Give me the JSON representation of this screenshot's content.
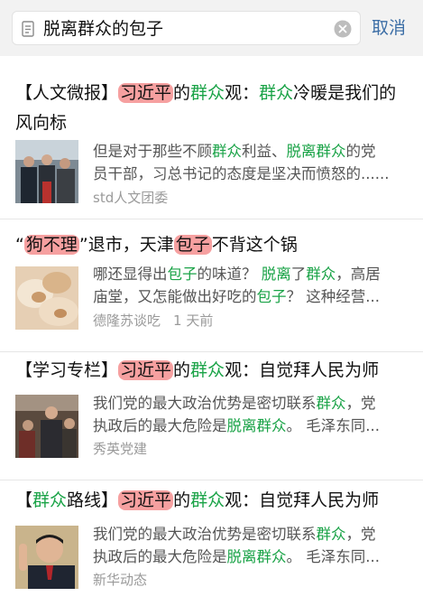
{
  "search": {
    "query": "脱离群众的包子",
    "cancel_label": "取消"
  },
  "results": [
    {
      "title": [
        {
          "t": "【人文微报】",
          "s": "n"
        },
        {
          "t": "习近平",
          "s": "r"
        },
        {
          "t": "的",
          "s": "n"
        },
        {
          "t": "群众",
          "s": "g"
        },
        {
          "t": "观：",
          "s": "n"
        },
        {
          "t": "群众",
          "s": "g"
        },
        {
          "t": "冷暖是我们的风向标",
          "s": "n"
        }
      ],
      "snippet_lines": [
        [
          {
            "t": "但是对于那些不顾",
            "s": "n"
          },
          {
            "t": "群众",
            "s": "g"
          },
          {
            "t": "利益、",
            "s": "n"
          },
          {
            "t": "脱离群众",
            "s": "g"
          },
          {
            "t": "的党",
            "s": "n"
          }
        ],
        [
          {
            "t": "员干部，习总书记的态度是坚决而愤怒的......",
            "s": "n"
          }
        ]
      ],
      "source": "std人文团委",
      "time": ""
    },
    {
      "title": [
        {
          "t": "“",
          "s": "n"
        },
        {
          "t": "狗不理",
          "s": "r"
        },
        {
          "t": "”退市，天津",
          "s": "n"
        },
        {
          "t": "包子",
          "s": "r"
        },
        {
          "t": "不背这个锅",
          "s": "n"
        }
      ],
      "snippet_lines": [
        [
          {
            "t": "哪还显得出",
            "s": "n"
          },
          {
            "t": "包子",
            "s": "g"
          },
          {
            "t": "的味道？ ",
            "s": "n"
          },
          {
            "t": "脱离",
            "s": "g"
          },
          {
            "t": "了",
            "s": "n"
          },
          {
            "t": "群众",
            "s": "g"
          },
          {
            "t": "，高居",
            "s": "n"
          }
        ],
        [
          {
            "t": "庙堂，又怎能做出好吃的",
            "s": "n"
          },
          {
            "t": "包子",
            "s": "g"
          },
          {
            "t": "？ 这种经营...",
            "s": "n"
          }
        ]
      ],
      "source": "德隆苏谈吃",
      "time": "1 天前"
    },
    {
      "title": [
        {
          "t": "【学习专栏】",
          "s": "n"
        },
        {
          "t": "习近平",
          "s": "r"
        },
        {
          "t": "的",
          "s": "n"
        },
        {
          "t": "群众",
          "s": "g"
        },
        {
          "t": "观：自觉拜人民为师",
          "s": "n"
        }
      ],
      "snippet_lines": [
        [
          {
            "t": "我们党的最大政治优势是密切联系",
            "s": "n"
          },
          {
            "t": "群众",
            "s": "g"
          },
          {
            "t": "，党",
            "s": "n"
          }
        ],
        [
          {
            "t": "执政后的最大危险是",
            "s": "n"
          },
          {
            "t": "脱离群众",
            "s": "g"
          },
          {
            "t": "。 毛泽东同...",
            "s": "n"
          }
        ]
      ],
      "source": "秀英党建",
      "time": ""
    },
    {
      "title": [
        {
          "t": "【",
          "s": "n"
        },
        {
          "t": "群众",
          "s": "g"
        },
        {
          "t": "路线】",
          "s": "n"
        },
        {
          "t": "习近平",
          "s": "r"
        },
        {
          "t": "的",
          "s": "n"
        },
        {
          "t": "群众",
          "s": "g"
        },
        {
          "t": "观：自觉拜人民为师",
          "s": "n"
        }
      ],
      "snippet_lines": [
        [
          {
            "t": "我们党的最大政治优势是密切联系",
            "s": "n"
          },
          {
            "t": "群众",
            "s": "g"
          },
          {
            "t": "，党",
            "s": "n"
          }
        ],
        [
          {
            "t": "执政后的最大危险是",
            "s": "n"
          },
          {
            "t": "脱离群众",
            "s": "g"
          },
          {
            "t": "。 毛泽东同...",
            "s": "n"
          }
        ]
      ],
      "source": "新华动态",
      "time": ""
    }
  ],
  "icons": {
    "search": "document-search-icon",
    "clear": "clear-circle-icon"
  },
  "colors": {
    "highlight_red": "#f6a0a0",
    "highlight_green": "#1aa347",
    "cancel_blue": "#3c6ea6"
  }
}
